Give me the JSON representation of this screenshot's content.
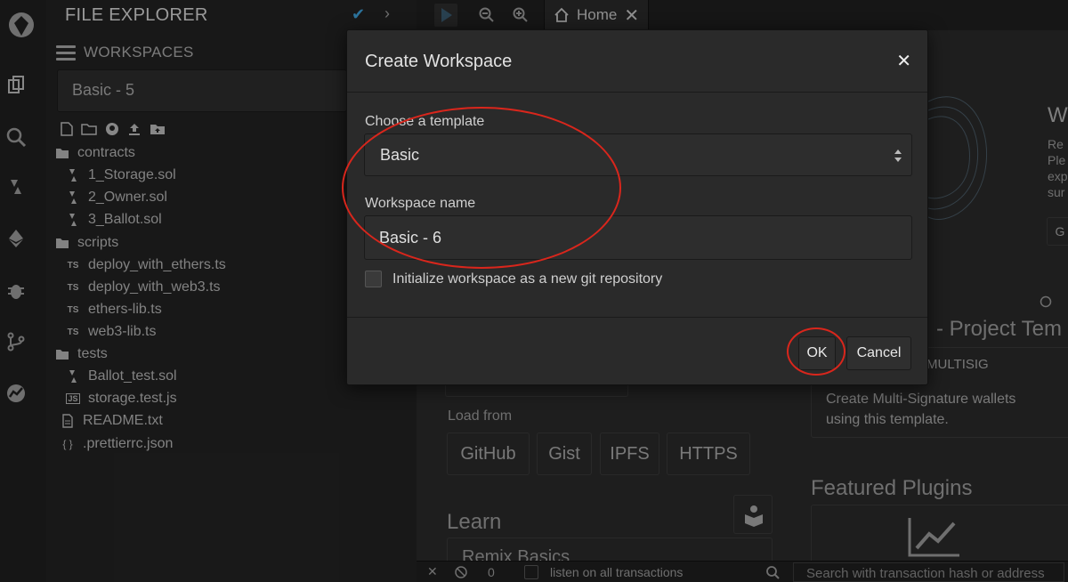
{
  "explorer": {
    "title": "FILE EXPLORER",
    "workspaces_label": "WORKSPACES",
    "current_workspace": "Basic - 5",
    "tree": [
      {
        "type": "folder",
        "label": "contracts"
      },
      {
        "type": "sol",
        "label": "1_Storage.sol"
      },
      {
        "type": "sol",
        "label": "2_Owner.sol"
      },
      {
        "type": "sol",
        "label": "3_Ballot.sol"
      },
      {
        "type": "folder",
        "label": "scripts"
      },
      {
        "type": "ts",
        "label": "deploy_with_ethers.ts"
      },
      {
        "type": "ts",
        "label": "deploy_with_web3.ts"
      },
      {
        "type": "ts",
        "label": "ethers-lib.ts"
      },
      {
        "type": "ts",
        "label": "web3-lib.ts"
      },
      {
        "type": "folder",
        "label": "tests"
      },
      {
        "type": "sol",
        "label": "Ballot_test.sol"
      },
      {
        "type": "js",
        "label": "storage.test.js"
      },
      {
        "type": "txt",
        "label": "README.txt"
      },
      {
        "type": "json",
        "label": ".prettierrc.json"
      }
    ]
  },
  "tabs": {
    "home_label": "Home"
  },
  "main": {
    "load_from_label": "Load from",
    "load_buttons": [
      "GitHub",
      "Gist",
      "IPFS",
      "HTTPS"
    ],
    "learn_label": "Learn",
    "remix_basics": "Remix Basics",
    "project_templates_heading": "- Project Tem",
    "multisig_title": "MULTISIG",
    "multisig_desc": "Create Multi-Signature wallets using this template.",
    "featured_plugins": "Featured Plugins",
    "right_frag_w": "W",
    "right_frag_lines": [
      "Re",
      "Ple",
      "exp",
      "sur"
    ],
    "right_frag_btn": "G",
    "status_count": "0",
    "status_listen": "listen on all transactions",
    "status_search_placeholder": "Search with transaction hash or address"
  },
  "modal": {
    "title": "Create Workspace",
    "template_label": "Choose a template",
    "template_value": "Basic",
    "name_label": "Workspace name",
    "name_value": "Basic - 6",
    "git_label": "Initialize workspace as a new git repository",
    "ok_label": "OK",
    "cancel_label": "Cancel"
  },
  "colors": {
    "annotation_red": "#d9261c",
    "accent_blue": "#3ea0d8"
  }
}
